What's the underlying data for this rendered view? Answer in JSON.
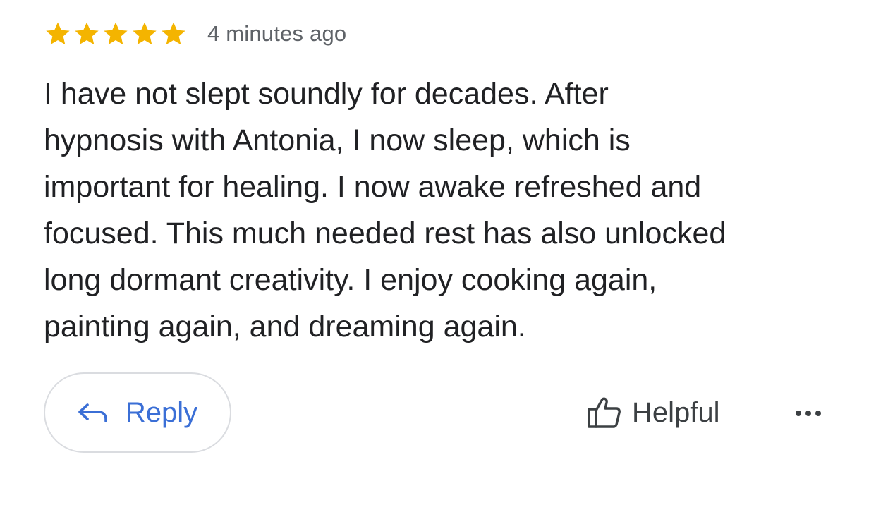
{
  "review": {
    "rating": 5,
    "rating_max": 5,
    "star_color": "#f4b400",
    "timestamp": "4 minutes ago",
    "text_lines": [
      "I have not slept soundly for decades. After",
      "hypnosis with Antonia, I now sleep, which is",
      "important for healing. I now awake refreshed and",
      "focused. This much needed rest has also unlocked",
      "long dormant creativity. I enjoy cooking again,",
      "painting again, and dreaming again."
    ]
  },
  "actions": {
    "reply_label": "Reply",
    "reply_icon": "reply-arrow-icon",
    "helpful_label": "Helpful",
    "helpful_icon": "thumbs-up-icon",
    "more_icon": "more-horizontal-icon",
    "accent_color": "#3b6fd6"
  }
}
